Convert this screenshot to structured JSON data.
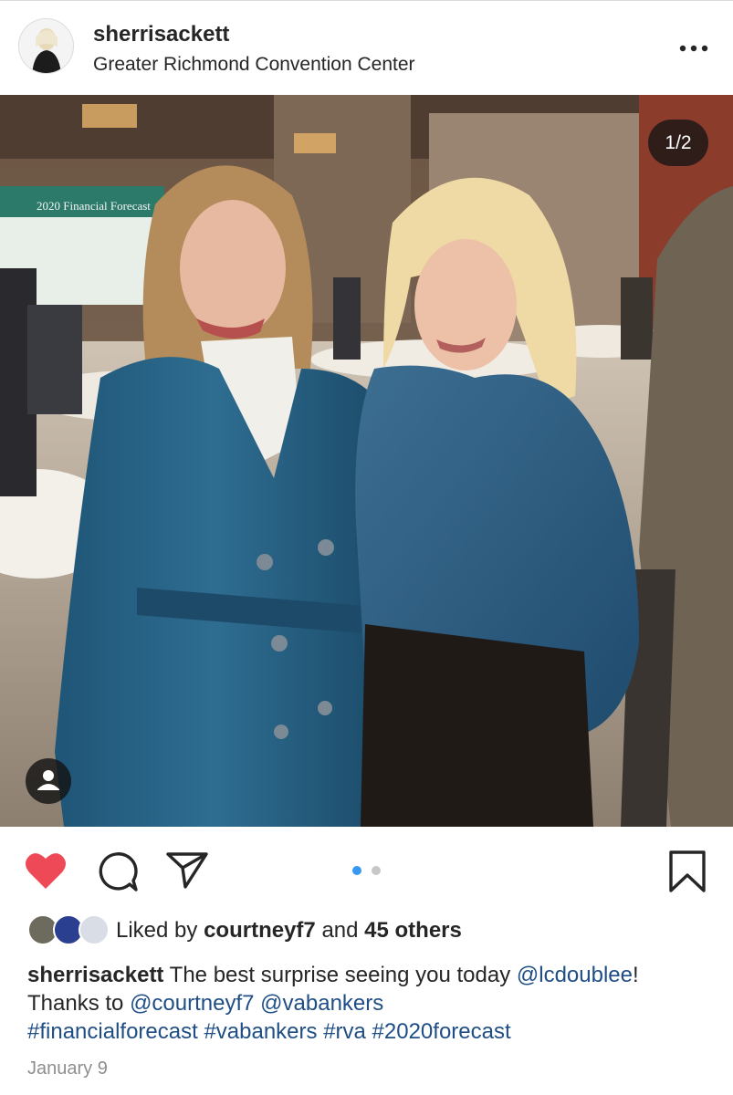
{
  "post": {
    "username": "sherrisackett",
    "location": "Greater Richmond Convention Center",
    "photo_counter": "1/2",
    "screen_text": "2020 Financial Forecast",
    "carousel": {
      "total": 2,
      "active": 1
    },
    "likes": {
      "prefix": "Liked by",
      "user": "courtneyf7",
      "middle": "and",
      "others": "45 others"
    },
    "caption": {
      "username": "sherrisackett",
      "text_1": " The best surprise seeing you today ",
      "mention_1": "@lcdoublee",
      "text_2": "! Thanks to ",
      "mention_2": "@courtneyf7",
      "text_3": " ",
      "mention_3": "@vabankers",
      "hashtags": "#financialforecast #vabankers #rva #2020forecast"
    },
    "date": "January 9"
  },
  "icons": {
    "more": "more-options-icon",
    "like": "heart-icon",
    "comment": "comment-icon",
    "share": "send-icon",
    "save": "bookmark-icon",
    "tag": "user-tag-icon"
  },
  "colors": {
    "heart": "#ed4956",
    "link": "#1f4e86",
    "active_dot": "#3897f0",
    "inactive_dot": "#c7c7c7",
    "muted": "#8e8e8e"
  }
}
